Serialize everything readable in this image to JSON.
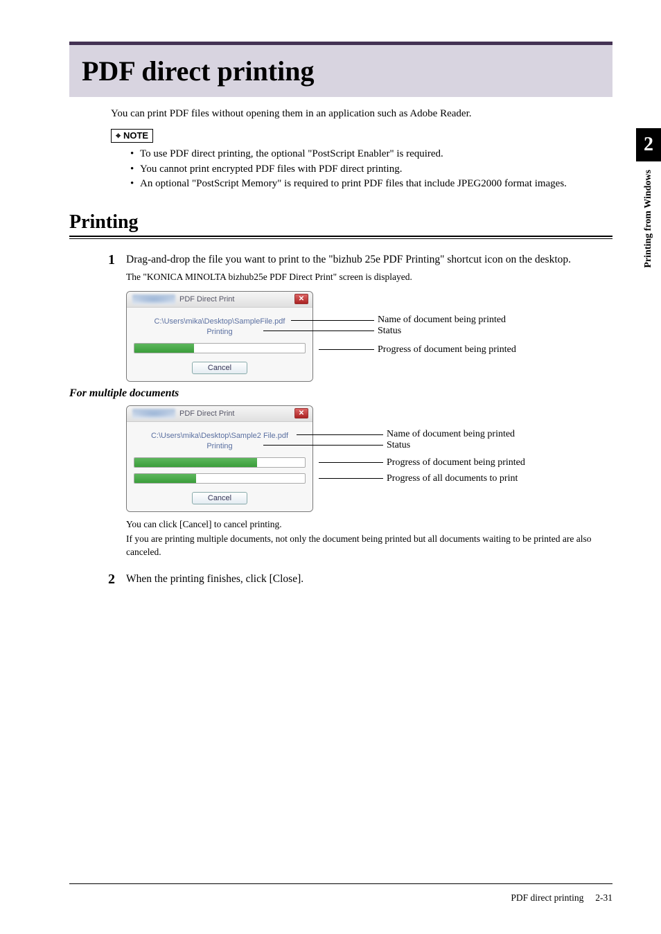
{
  "sideTab": {
    "number": "2",
    "label": "Printing from Windows"
  },
  "mainHeading": "PDF direct printing",
  "intro": "You can print PDF files without opening them in an application such as Adobe Reader.",
  "noteLabel": "NOTE",
  "notes": [
    "To use PDF direct printing, the optional \"PostScript Enabler\" is required.",
    "You cannot print encrypted PDF files with PDF direct printing.",
    "An optional \"PostScript Memory\" is required to print PDF files that include JPEG2000 format images."
  ],
  "sectionHeading": "Printing",
  "step1": {
    "num": "1",
    "text": "Drag-and-drop the file you want to print to the \"bizhub 25e PDF Printing\" shortcut icon on the desktop.",
    "sub": "The \"KONICA MINOLTA bizhub25e PDF Direct Print\" screen is displayed."
  },
  "dialog1": {
    "title": "PDF Direct Print",
    "path": "C:\\Users\\mika\\Desktop\\SampleFile.pdf",
    "status": "Printing",
    "cancel": "Cancel",
    "progress1": 35
  },
  "callouts1": {
    "name": "Name of document being printed",
    "status": "Status",
    "progress": "Progress of document being printed"
  },
  "subheading": "For multiple documents",
  "dialog2": {
    "title": "PDF Direct Print",
    "path": "C:\\Users\\mika\\Desktop\\Sample2 File.pdf",
    "status": "Printing",
    "cancel": "Cancel",
    "progress1": 72,
    "progress2": 36
  },
  "callouts2": {
    "name": "Name of document being printed",
    "status": "Status",
    "progress1": "Progress of document being printed",
    "progress2": "Progress of all documents to print"
  },
  "afterDialog2a": "You can click [Cancel] to cancel printing.",
  "afterDialog2b": "If you are printing multiple documents, not only the document being printed but all documents waiting to be printed are also canceled.",
  "step2": {
    "num": "2",
    "text": "When the printing finishes, click [Close]."
  },
  "footer": {
    "title": "PDF direct printing",
    "page": "2-31"
  }
}
